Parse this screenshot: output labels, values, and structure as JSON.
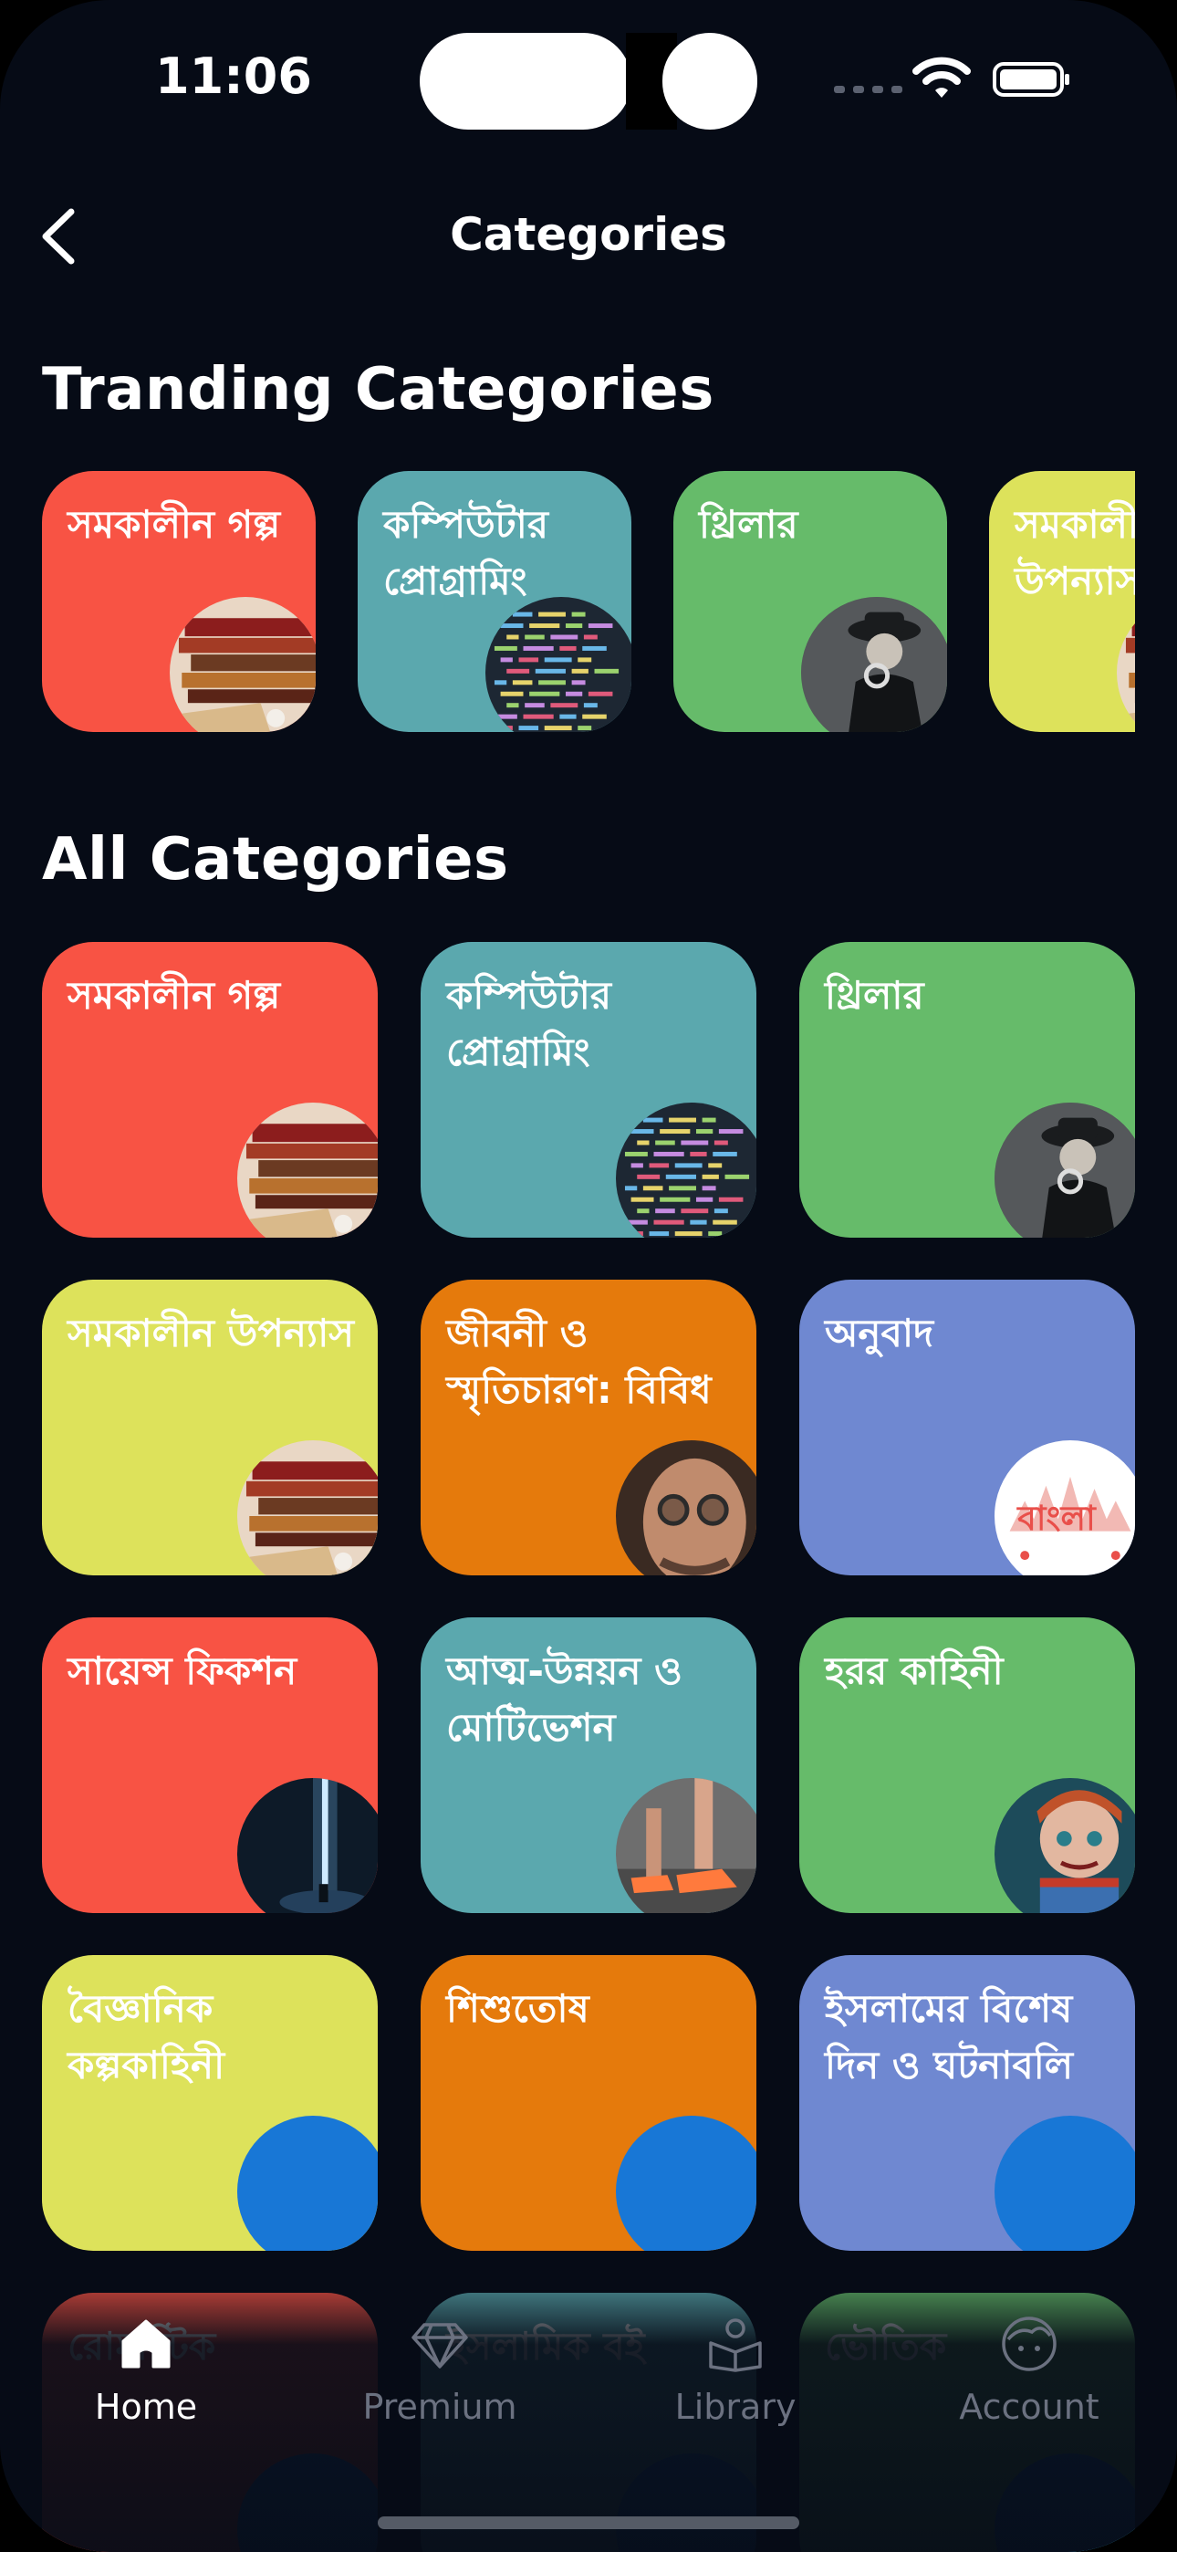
{
  "status_bar": {
    "time": "11:06"
  },
  "header": {
    "title": "Categories"
  },
  "sections": {
    "trending_title": "Tranding Categories",
    "all_title": "All Categories"
  },
  "colors": {
    "background": "#060b16",
    "red": "#f85344",
    "teal": "#5ba8ae",
    "green": "#66bb6a",
    "yellow": "#dde25b",
    "orange": "#e57a0c",
    "blue": "#6f88d1",
    "thumb_blue": "#1877d6"
  },
  "trending": [
    {
      "label": "সমকালীন গল্প",
      "color": "#f85344",
      "image": "books-image"
    },
    {
      "label": "কম্পিউটার প্রোগ্রামিং",
      "color": "#5ba8ae",
      "image": "code-image"
    },
    {
      "label": "থ্রিলার",
      "color": "#66bb6a",
      "image": "detective-image"
    },
    {
      "label": "সমকালীন উপন্যাস",
      "color": "#dde25b",
      "image": "books-image"
    }
  ],
  "categories": [
    {
      "label": "সমকালীন গল্প",
      "color": "#f85344",
      "image": "books-image"
    },
    {
      "label": "কম্পিউটার প্রোগ্রামিং",
      "color": "#5ba8ae",
      "image": "code-image"
    },
    {
      "label": "থ্রিলার",
      "color": "#66bb6a",
      "image": "detective-image"
    },
    {
      "label": "সমকালীন উপন্যাস",
      "color": "#dde25b",
      "image": "books-image"
    },
    {
      "label": "জীবনী ও স্মৃতিচারণ: বিবিধ",
      "color": "#e57a0c",
      "image": "portrait-image"
    },
    {
      "label": "অনুবাদ",
      "color": "#6f88d1",
      "image": "bangla-logo",
      "image_text": "বাংলা"
    },
    {
      "label": "সায়েন্স ফিকশন",
      "color": "#f85344",
      "image": "light-beam-image"
    },
    {
      "label": "আত্ম-উন্নয়ন ও মোটিভেশন",
      "color": "#5ba8ae",
      "image": "running-shoe-image"
    },
    {
      "label": "হরর কাহিনী",
      "color": "#66bb6a",
      "image": "doll-image"
    },
    {
      "label": "বৈজ্ঞানিক কল্পকাহিনী",
      "color": "#dde25b",
      "image": "blue-circle"
    },
    {
      "label": "শিশুতোষ",
      "color": "#e57a0c",
      "image": "blue-circle"
    },
    {
      "label": "ইসলামের বিশেষ দিন ও ঘটনাবলি",
      "color": "#6f88d1",
      "image": "blue-circle"
    },
    {
      "label": "রোমান্টিক",
      "color": "#f85344",
      "image": "blue-circle"
    },
    {
      "label": "ইসলামিক বই",
      "color": "#5ba8ae",
      "image": "blue-circle"
    },
    {
      "label": "ভৌতিক",
      "color": "#66bb6a",
      "image": "blue-circle"
    }
  ],
  "bottom_nav": [
    {
      "label": "Home",
      "icon": "home-icon",
      "active": true
    },
    {
      "label": "Premium",
      "icon": "diamond-icon",
      "active": false
    },
    {
      "label": "Library",
      "icon": "library-icon",
      "active": false
    },
    {
      "label": "Account",
      "icon": "account-icon",
      "active": false
    }
  ]
}
